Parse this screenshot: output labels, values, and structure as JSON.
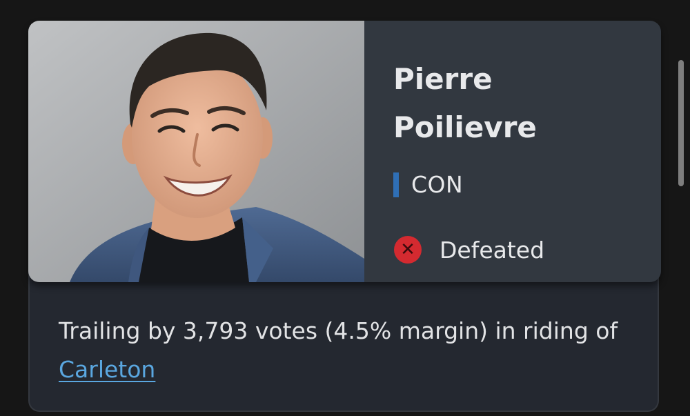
{
  "candidate": {
    "first_name": "Pierre",
    "last_name": "Poilievre",
    "photo_icon": "candidate-portrait",
    "party": {
      "label": "CON",
      "color": "#2f6fb6"
    },
    "status": {
      "label": "Defeated",
      "icon": "x-circle-icon",
      "icon_glyph": "✕",
      "color": "#d42a30"
    }
  },
  "result": {
    "summary_text": "Trailing by 3,793 votes (4.5% margin) in riding of",
    "riding_link": "Carleton"
  },
  "colors": {
    "page_background": "#161616",
    "card_top": "#323840",
    "card_bottom": "#242830",
    "link": "#5aa7e0"
  }
}
